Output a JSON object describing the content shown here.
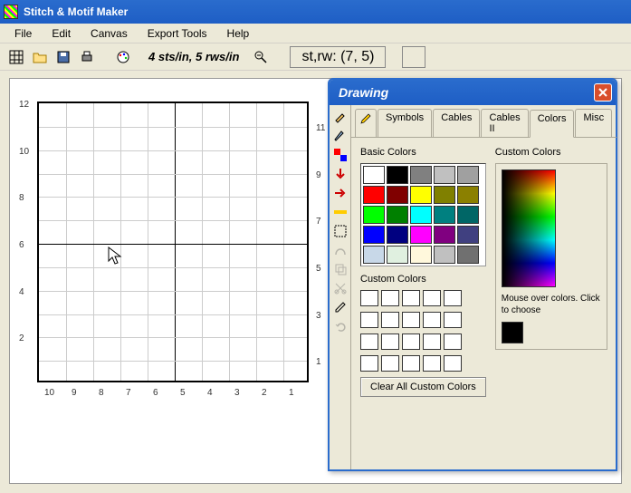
{
  "title": "Stitch & Motif Maker",
  "menu": [
    "File",
    "Edit",
    "Canvas",
    "Export Tools",
    "Help"
  ],
  "toolbar": {
    "gauge": "4 sts/in, 5 rws/in",
    "coord": "st,rw: (7, 5)"
  },
  "grid": {
    "rows": 12,
    "cols": 10,
    "row_labels": [
      "12",
      "",
      "10",
      "",
      "8",
      "",
      "6",
      "",
      "4",
      "",
      "2",
      ""
    ],
    "col_labels_right": [
      "",
      "11",
      "",
      "9",
      "",
      "7",
      "",
      "5",
      "",
      "3",
      "",
      "1"
    ],
    "bottom_labels": [
      "10",
      "9",
      "8",
      "7",
      "6",
      "5",
      "4",
      "3",
      "2",
      "1"
    ]
  },
  "panel": {
    "title": "Drawing",
    "tabs": [
      "Symbols",
      "Cables",
      "Cables II",
      "Colors",
      "Misc"
    ],
    "active_tab": 3,
    "basic_label": "Basic Colors",
    "custom_label": "Custom Colors",
    "custom_slots_label": "Custom Colors",
    "hint": "Mouse over colors. Click to choose",
    "clear_btn": "Clear All Custom Colors",
    "basic_colors": [
      "#ffffff",
      "#000000",
      "#808080",
      "#c0c0c0",
      "#a0a0a0",
      "#ff0000",
      "#800000",
      "#ffff00",
      "#808000",
      "#8b8000",
      "#00ff00",
      "#008000",
      "#00ffff",
      "#008080",
      "#006666",
      "#0000ff",
      "#000080",
      "#ff00ff",
      "#800080",
      "#404080",
      "#c8d8e8",
      "#e0f0e0",
      "#fff8dc",
      "#c0c0c0",
      "#707070"
    ]
  }
}
